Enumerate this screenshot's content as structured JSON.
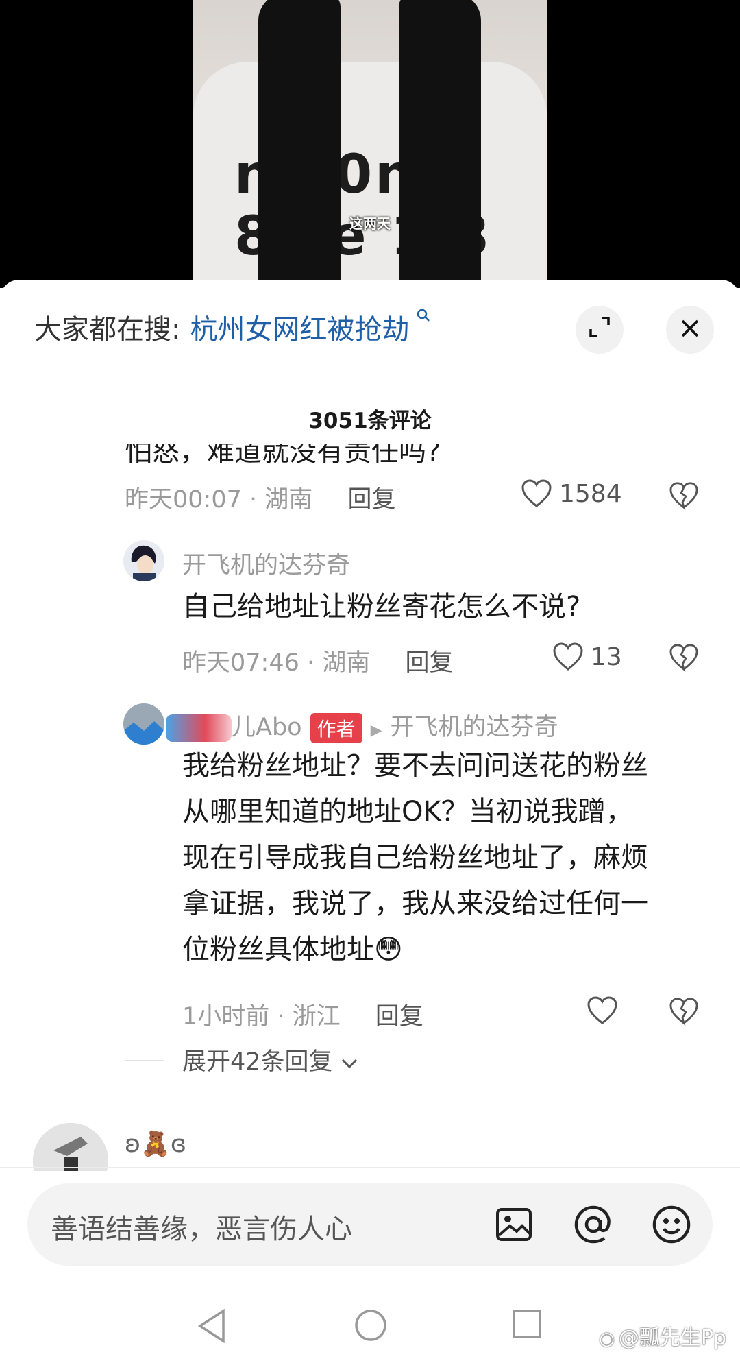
{
  "video": {
    "subtitle": "这两天",
    "shirt_line1": "nal0nal",
    "shirt_line2": "8  ce 1 8"
  },
  "header": {
    "search_prefix": "大家都在搜:",
    "search_keyword": "杭州女网红被抢劫",
    "search_icon": "search-icon",
    "expand_icon": "expand-icon",
    "close_icon": "close-icon",
    "comment_count": "3051条评论"
  },
  "comments": [
    {
      "cut_text": "怕怒，难道就没有责任吗?",
      "time": "昨天00:07",
      "location": "湖南",
      "reply_label": "回复",
      "likes": "1584"
    },
    {
      "username": "开飞机的达芬奇",
      "text": "自己给地址让粉丝寄花怎么不说?",
      "time": "昨天07:46",
      "location": "湖南",
      "reply_label": "回复",
      "likes": "13"
    },
    {
      "username": "儿Abo",
      "author_tag": "作者",
      "reply_to": "开飞机的达芬奇",
      "text_lines": [
        "我给粉丝地址？要不去问问送花的粉丝",
        "从哪里知道的地址OK？当初说我蹭，",
        "现在引导成我自己给粉丝地址了，麻烦",
        "拿证据，我说了，我从来没给过任何一",
        "位粉丝具体地址"
      ],
      "emoji": "😳",
      "time": "1小时前",
      "location": "浙江",
      "reply_label": "回复",
      "likes": ""
    }
  ],
  "expand_replies": "展开42条回复",
  "next_comment": {
    "username": "ʚ🧸ɞ"
  },
  "meta_separator": "·",
  "input": {
    "placeholder": "善语结善缘，恶言伤人心",
    "icons": [
      "image-icon",
      "at-icon",
      "emoji-icon"
    ]
  },
  "watermark": "@瓢先生Pp",
  "colors": {
    "accent_red": "#e6414a",
    "link_blue": "#1f5fa8"
  }
}
